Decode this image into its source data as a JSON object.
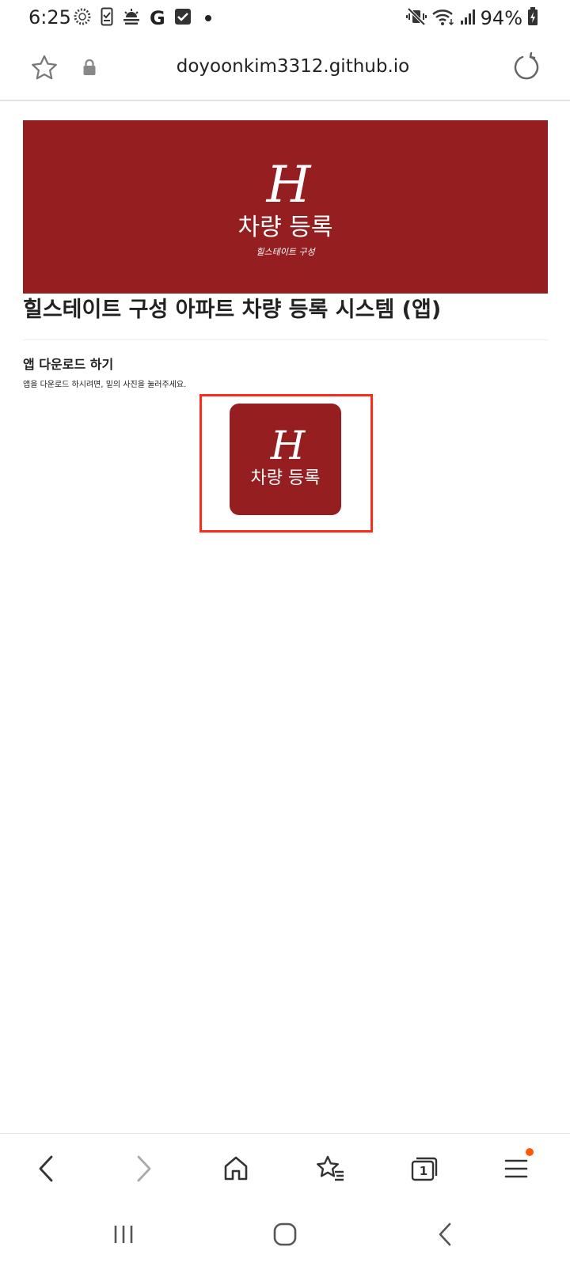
{
  "status_bar": {
    "time": "6:25",
    "battery_percent": "94%",
    "notification_icons": [
      "sync-icon",
      "phone-check-icon",
      "weather-icon",
      "google-icon",
      "task-check-icon",
      "dot-icon"
    ],
    "system_icons": [
      "mute-vibrate-icon",
      "wifi-icon",
      "signal-icon",
      "battery-charging-icon"
    ],
    "google_letter": "G"
  },
  "browser": {
    "url": "doyoonkim3312.github.io",
    "tab_count": "1",
    "menu_badge_color": "#ff5a00"
  },
  "banner": {
    "monogram": "H",
    "title": "차량 등록",
    "subtitle": "힐스테이트 구성",
    "color": "#941e20"
  },
  "page": {
    "title": "힐스테이트 구성 아파트 차량 등록 시스템 (앱)",
    "section_heading": "앱 다운로드 하기",
    "section_description": "앱을 다운로드 하시려면, 밑의 사진을 눌러주세요."
  },
  "app_icon": {
    "monogram": "H",
    "title": "차량 등록",
    "highlight_color": "#ff2b1a"
  }
}
